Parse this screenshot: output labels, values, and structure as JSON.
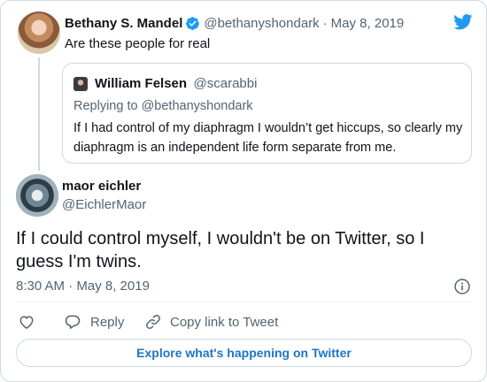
{
  "parent_tweet": {
    "name": "Bethany S. Mandel",
    "handle": "@bethanyshondark",
    "separator": "·",
    "date": "May 8, 2019",
    "text": "Are these people for real"
  },
  "quoted_tweet": {
    "name": "William Felsen",
    "handle": "@scarabbi",
    "replying_to": "Replying to @bethanyshondark",
    "text": "If I had control of my diaphragm I wouldn’t get hiccups, so clearly my diaphragm is an independent life form separate from me."
  },
  "main_tweet": {
    "name": "maor eichler",
    "handle": "@EichlerMaor",
    "text": "If I could control myself, I wouldn't be on Twitter, so I guess I'm twins.",
    "timestamp": "8:30 AM · May 8, 2019"
  },
  "actions": {
    "reply_label": "Reply",
    "copy_link_label": "Copy link to Tweet"
  },
  "explore_button_label": "Explore what's happening on Twitter",
  "colors": {
    "twitter_blue": "#1d9bf0",
    "secondary_text": "#536471",
    "border": "#cfd9de",
    "explore_text": "#1d75c7"
  },
  "icons": [
    "verified-badge-icon",
    "twitter-bird-icon",
    "info-icon",
    "heart-icon",
    "reply-icon",
    "link-icon"
  ]
}
